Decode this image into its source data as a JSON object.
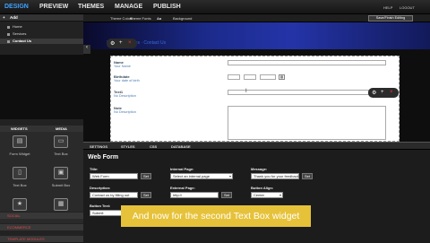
{
  "nav": {
    "tabs": [
      "DESIGN",
      "PREVIEW",
      "THEMES",
      "MANAGE",
      "PUBLISH"
    ],
    "right_links": [
      "HELP",
      "LOGOUT"
    ]
  },
  "sidebar": {
    "header": "Add",
    "pages": [
      "Home",
      "Services",
      "Contact Us"
    ],
    "widget_tabs": [
      "WIDGETS",
      "MEDIA"
    ],
    "widgets": [
      {
        "label": "Form Widget",
        "icon": "form-icon"
      },
      {
        "label": "Text Box",
        "icon": "textbox-icon"
      },
      {
        "label": "Text Box",
        "icon": "textbox-icon"
      },
      {
        "label": "Submit Box",
        "icon": "submit-box-icon"
      },
      {
        "label": "Star Rating",
        "icon": "star-icon"
      },
      {
        "label": "Datepicker",
        "icon": "calendar-icon"
      }
    ],
    "sections": [
      "SOCIAL",
      "ECOMMERCE",
      "TEMPLATE MODULES"
    ]
  },
  "canvas": {
    "toolbar": [
      "Theme Colors",
      "Theme Fonts",
      "Aa",
      "Background"
    ],
    "finish_button": "Save/Finish Editing",
    "breadcrumb": "Home · Services · Contact Us",
    "form": [
      {
        "label": "Name",
        "desc": "Your Name"
      },
      {
        "label": "Birthdate",
        "desc": "Your date of birth"
      },
      {
        "label": "Text1",
        "desc": "No Description"
      },
      {
        "label": "Note",
        "desc": "No Description"
      }
    ]
  },
  "panel": {
    "tabs": [
      "SETTINGS",
      "STYLES",
      "CSS",
      "DATABASE"
    ],
    "title": "Web Form",
    "title_label": "Title:",
    "title_value": "Web Form",
    "set": "Set",
    "description_label": "Description:",
    "description_value": "Contact us by filling out",
    "button_text_label": "Button Text:",
    "button_text_value": "Submit",
    "internal_page_label": "Internal Page:",
    "internal_page_value": "Select an internal page",
    "external_page_label": "External Page:",
    "external_page_value": "http://",
    "message_label": "Message:",
    "message_value": "Thank you for your feedback",
    "button_align_label": "Button Align:",
    "button_align_value": "Center"
  },
  "caption": "And now for the second Text Box widget"
}
